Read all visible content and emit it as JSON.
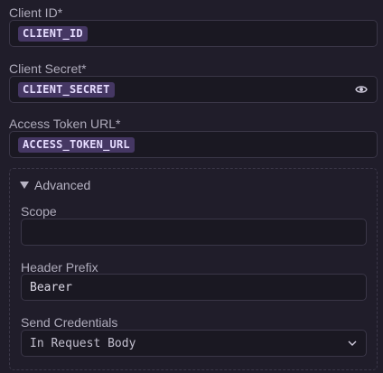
{
  "client_id": {
    "label": "Client ID",
    "required_mark": "*",
    "value": "CLIENT_ID"
  },
  "client_secret": {
    "label": "Client Secret",
    "required_mark": "*",
    "value": "CLIENT_SECRET",
    "toggle_icon": "eye-icon"
  },
  "access_token_url": {
    "label": "Access Token URL",
    "required_mark": "*",
    "value": "ACCESS_TOKEN_URL"
  },
  "advanced": {
    "title": "Advanced",
    "scope": {
      "label": "Scope",
      "value": ""
    },
    "header_prefix": {
      "label": "Header Prefix",
      "value": "Bearer"
    },
    "send_credentials": {
      "label": "Send Credentials",
      "value": "In Request Body",
      "options": [
        "In Request Body"
      ]
    }
  },
  "colors": {
    "background": "#201d2a",
    "chip": "#453763",
    "chip_text": "#e6dcff",
    "border": "#3a3647"
  }
}
